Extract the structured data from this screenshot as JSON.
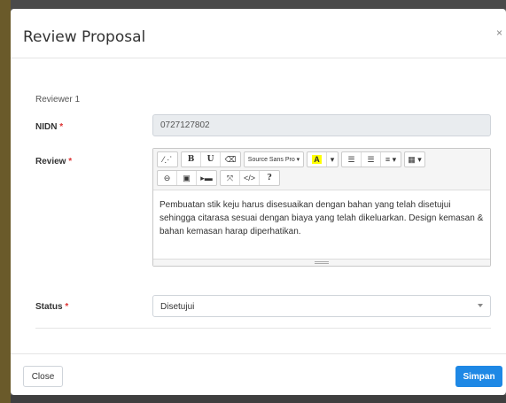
{
  "modal": {
    "title": "Review Proposal",
    "close_icon": "×"
  },
  "form": {
    "reviewer_label": "Reviewer 1",
    "nidn": {
      "label": "NIDN",
      "required_mark": "*",
      "value": "0727127802"
    },
    "review": {
      "label": "Review",
      "required_mark": "*",
      "content": "Pembuatan stik keju harus disesuaikan dengan bahan yang telah disetujui sehingga citarasa sesuai dengan biaya yang telah dikeluarkan. Design kemasan & bahan kemasan harap diperhatikan."
    },
    "status": {
      "label": "Status",
      "required_mark": "*",
      "value": "Disetujui"
    }
  },
  "toolbar": {
    "magic": "⁄⋰",
    "bold": "B",
    "underline": "U",
    "eraser": "⌫",
    "font": "Source Sans Pro ▾",
    "highlight": "A",
    "highlight_caret": "▾",
    "ul": "☰",
    "ol": "☰",
    "align": "≡ ▾",
    "table": "▦ ▾",
    "link": "⊖",
    "picture": "▣",
    "video": "▸▬",
    "fullscreen": "⤧",
    "code": "</>",
    "help": "?"
  },
  "footer": {
    "close_label": "Close",
    "save_label": "Simpan"
  },
  "colors": {
    "primary": "#1e88e5",
    "required": "#dd3333",
    "highlight": "#ffff00"
  }
}
